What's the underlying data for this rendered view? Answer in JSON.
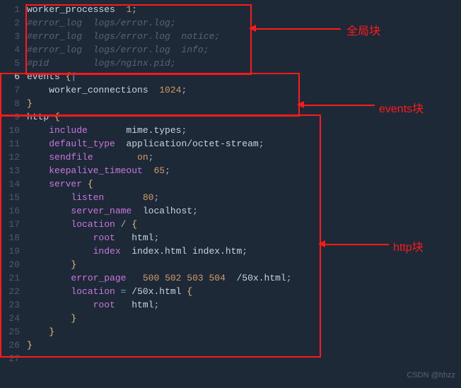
{
  "lines": [
    {
      "n": 1,
      "cls": "code",
      "html": "worker_processes  <span class='num'>1</span><span class='plain'>;</span>"
    },
    {
      "n": 2,
      "cls": "cmt",
      "html": "#error_log  logs/error.log;"
    },
    {
      "n": 3,
      "cls": "cmt",
      "html": "#error_log  logs/error.log  notice;"
    },
    {
      "n": 4,
      "cls": "cmt",
      "html": "#error_log  logs/error.log  info;"
    },
    {
      "n": 5,
      "cls": "cmt",
      "html": "#pid        logs/nginx.pid;"
    },
    {
      "n": 6,
      "cls": "code hl",
      "html": "events <span class='brace'>{</span><span class='caret'>|</span>"
    },
    {
      "n": 7,
      "cls": "code",
      "html": "    worker_connections  <span class='num'>1024</span><span class='plain'>;</span>"
    },
    {
      "n": 8,
      "cls": "code",
      "html": "<span class='brace'>}</span>"
    },
    {
      "n": 9,
      "cls": "code",
      "html": "http <span class='brace'>{</span>"
    },
    {
      "n": 10,
      "cls": "code",
      "html": "    <span class='ident'>include</span>       mime.types<span class='plain'>;</span>"
    },
    {
      "n": 11,
      "cls": "code",
      "html": "    <span class='ident'>default_type</span>  application/octet-stream<span class='plain'>;</span>"
    },
    {
      "n": 12,
      "cls": "code",
      "html": "    <span class='ident'>sendfile</span>        <span class='kw'>on</span><span class='plain'>;</span>"
    },
    {
      "n": 13,
      "cls": "code",
      "html": "    <span class='ident'>keepalive_timeout</span>  <span class='num'>65</span><span class='plain'>;</span>"
    },
    {
      "n": 14,
      "cls": "code",
      "html": "    <span class='ident'>server</span> <span class='brace'>{</span>"
    },
    {
      "n": 15,
      "cls": "code",
      "html": "        <span class='ident'>listen</span>       <span class='num'>80</span><span class='plain'>;</span>"
    },
    {
      "n": 16,
      "cls": "code",
      "html": "        <span class='ident'>server_name</span>  localhost<span class='plain'>;</span>"
    },
    {
      "n": 17,
      "cls": "code",
      "html": "        <span class='ident'>location</span> <span class='plain'>/</span> <span class='brace'>{</span>"
    },
    {
      "n": 18,
      "cls": "code",
      "html": "            <span class='ident'>root</span>   html<span class='plain'>;</span>"
    },
    {
      "n": 19,
      "cls": "code",
      "html": "            <span class='ident'>index</span>  index.html index.htm<span class='plain'>;</span>"
    },
    {
      "n": 20,
      "cls": "code",
      "html": "        <span class='brace'>}</span>"
    },
    {
      "n": 21,
      "cls": "code",
      "html": "        <span class='ident'>error_page</span>   <span class='num'>500</span> <span class='num'>502</span> <span class='num'>503</span> <span class='num'>504</span>  /50x.html<span class='plain'>;</span>"
    },
    {
      "n": 22,
      "cls": "code",
      "html": "        <span class='ident'>location</span> <span class='op'>=</span> /50x.html <span class='brace'>{</span>"
    },
    {
      "n": 23,
      "cls": "code",
      "html": "            <span class='ident'>root</span>   html<span class='plain'>;</span>"
    },
    {
      "n": 24,
      "cls": "code",
      "html": "        <span class='brace'>}</span>"
    },
    {
      "n": 25,
      "cls": "code",
      "html": "    <span class='brace'>}</span>"
    },
    {
      "n": 26,
      "cls": "code",
      "html": "<span class='brace'>}</span>"
    },
    {
      "n": 27,
      "cls": "code",
      "html": ""
    }
  ],
  "annotations": {
    "global_block": "全局块",
    "events_block": "events块",
    "http_block": "http块"
  },
  "watermark": "CSDN @hhzz"
}
